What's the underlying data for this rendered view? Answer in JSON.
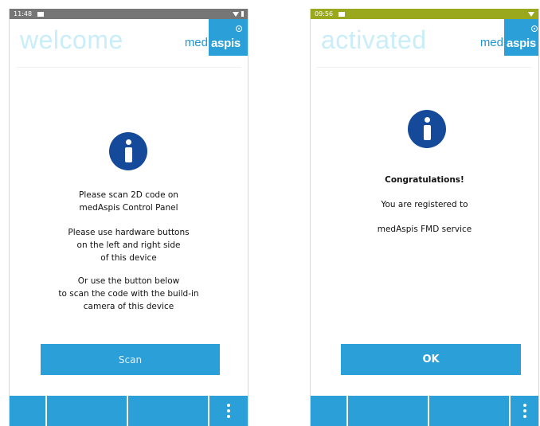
{
  "left_screen": {
    "status_time": "11:48",
    "header_title": "welcome",
    "logo": {
      "med": "med",
      "aspis": "aspis"
    },
    "instructions": [
      [
        "Please scan 2D code on",
        "medAspis Control Panel"
      ],
      [
        "Please use hardware buttons",
        "on the left and right side",
        "of this device"
      ],
      [
        "Or use the button below",
        "to scan the code with the build-in",
        "camera of this device"
      ]
    ],
    "scan_button_label": "Scan"
  },
  "right_screen": {
    "status_time": "09:56",
    "header_title": "activated",
    "logo": {
      "med": "med",
      "aspis": "aspis"
    },
    "congrats": "Congratulations!",
    "registered": "You are registered to",
    "service": "medAspis FMD service",
    "ok_button_label": "OK"
  },
  "colors": {
    "accent": "#2a9fd8",
    "info_icon": "#154a9b",
    "status_bar_left": "#767676",
    "status_bar_right": "#9aa81e"
  },
  "icons": [
    "info-icon",
    "overflow-menu-icon",
    "wifi-icon",
    "battery-icon",
    "notification-icon"
  ]
}
